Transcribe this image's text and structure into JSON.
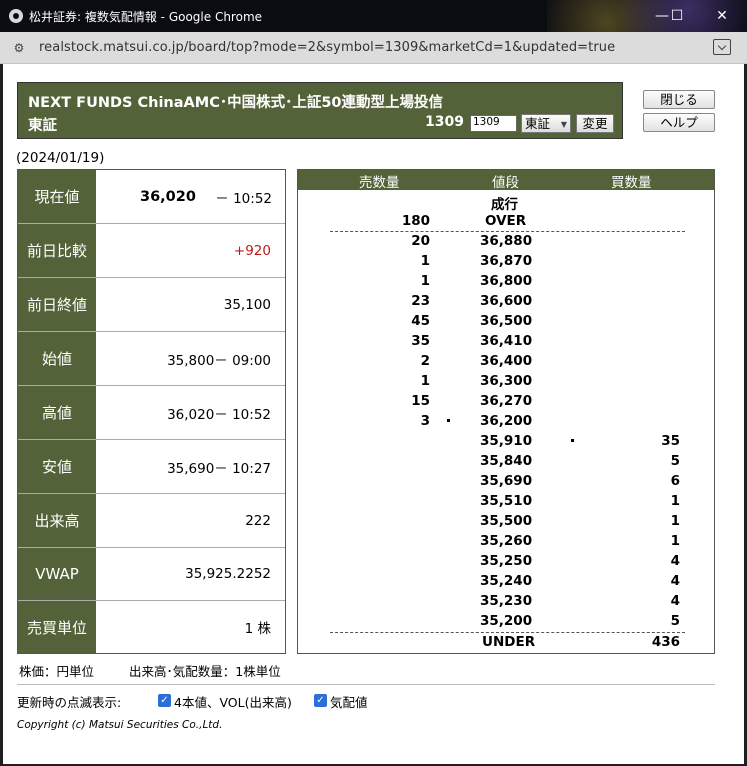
{
  "window": {
    "title": "松井証券: 複数気配情報 - Google Chrome",
    "minimize": "—",
    "maximize": "☐",
    "close": "✕"
  },
  "address_bar": {
    "url": "realstock.matsui.co.jp/board/top?mode=2&symbol=1309&marketCd=1&updated=true"
  },
  "header": {
    "name": "NEXT FUNDS ChinaAMC･中国株式･上証50連動型上場投信",
    "market": "東証",
    "code": "1309",
    "code_input": "1309",
    "market_select": "東証",
    "change_button": "変更"
  },
  "side_buttons": {
    "close": "閉じる",
    "help": "ヘルプ"
  },
  "date": "(2024/01/19)",
  "info": {
    "current": {
      "label": "現在値",
      "price": "36,020",
      "time": "－ 10:52"
    },
    "change": {
      "label": "前日比較",
      "value": "+920"
    },
    "prev_close": {
      "label": "前日終値",
      "value": "35,100"
    },
    "open": {
      "label": "始値",
      "value": "35,800－ 09:00"
    },
    "high": {
      "label": "高値",
      "value": "36,020－ 10:52"
    },
    "low": {
      "label": "安値",
      "value": "35,690－ 10:27"
    },
    "volume": {
      "label": "出来高",
      "value": "222"
    },
    "vwap": {
      "label": "VWAP",
      "value": "35,925.2252"
    },
    "unit": {
      "label": "売買単位",
      "value": "1 株"
    }
  },
  "book": {
    "headers": {
      "sell": "売数量",
      "price": "値段",
      "buy": "買数量"
    },
    "market_label": "成行",
    "over": {
      "qty": "180",
      "label": "OVER"
    },
    "asks": [
      {
        "qty": "20",
        "price": "36,880"
      },
      {
        "qty": "1",
        "price": "36,870"
      },
      {
        "qty": "1",
        "price": "36,800"
      },
      {
        "qty": "23",
        "price": "36,600"
      },
      {
        "qty": "45",
        "price": "36,500"
      },
      {
        "qty": "35",
        "price": "36,410"
      },
      {
        "qty": "2",
        "price": "36,400"
      },
      {
        "qty": "1",
        "price": "36,300"
      },
      {
        "qty": "15",
        "price": "36,270"
      },
      {
        "qty": "3",
        "price": "36,200"
      }
    ],
    "bids": [
      {
        "price": "35,910",
        "qty": "35"
      },
      {
        "price": "35,840",
        "qty": "5"
      },
      {
        "price": "35,690",
        "qty": "6"
      },
      {
        "price": "35,510",
        "qty": "1"
      },
      {
        "price": "35,500",
        "qty": "1"
      },
      {
        "price": "35,260",
        "qty": "1"
      },
      {
        "price": "35,250",
        "qty": "4"
      },
      {
        "price": "35,240",
        "qty": "4"
      },
      {
        "price": "35,230",
        "qty": "4"
      },
      {
        "price": "35,200",
        "qty": "5"
      }
    ],
    "under": {
      "label": "UNDER",
      "qty": "436"
    }
  },
  "footnotes": {
    "price_unit": "株価：円単位",
    "volume_unit": "出来高･気配数量：1株単位"
  },
  "options": {
    "label": "更新時の点滅表示:",
    "ohlc_vol": {
      "label": "4本値、VOL(出来高)",
      "checked": true
    },
    "quote": {
      "label": "気配値",
      "checked": true
    },
    "check_mark": "✓"
  },
  "copyright": "Copyright (c) Matsui Securities Co.,Ltd."
}
